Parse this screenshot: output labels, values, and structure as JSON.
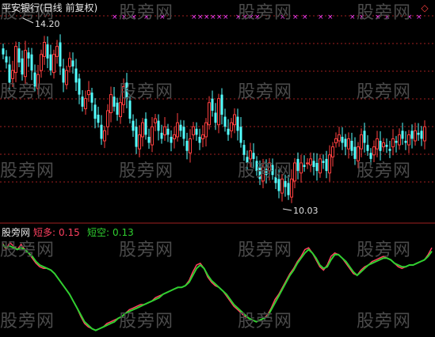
{
  "header": {
    "title": "平安银行(日线 前复权)"
  },
  "price_panel": {
    "high_label": "14.20",
    "low_label": "10.03"
  },
  "indicator_panel": {
    "name": "股旁网",
    "short_long_label": "短多:",
    "short_long_value": "0.15",
    "short_empty_label": "短空:",
    "short_empty_value": "0.13"
  },
  "watermark": "股旁网",
  "icons": {
    "corner": "diamond-icon"
  },
  "colors": {
    "up": "#ff4040",
    "down": "#54ffff",
    "short_long": "#ff4060",
    "short_empty": "#30d030",
    "signal": "#ff40ff",
    "grid": "#a02020"
  },
  "chart_data": [
    {
      "type": "candlestick",
      "ylim": [
        9.6,
        14.6
      ],
      "high": 14.2,
      "low": 10.03,
      "close": [
        13.6,
        13.4,
        12.9,
        13.2,
        13.8,
        13.4,
        13.1,
        13.7,
        13.5,
        13.2,
        12.8,
        13.1,
        13.6,
        13.9,
        13.5,
        13.2,
        13.6,
        13.8,
        13.3,
        12.9,
        13.2,
        13.5,
        13.3,
        12.9,
        12.6,
        12.3,
        12.5,
        12.7,
        12.4,
        12.0,
        11.9,
        11.5,
        11.7,
        12.2,
        12.6,
        12.3,
        12.1,
        12.4,
        12.8,
        12.5,
        12.0,
        11.7,
        11.3,
        11.6,
        11.9,
        11.6,
        11.4,
        11.8,
        12.0,
        11.7,
        11.5,
        11.8,
        11.6,
        11.4,
        11.6,
        11.9,
        11.7,
        11.5,
        11.2,
        11.5,
        11.8,
        11.6,
        11.4,
        11.6,
        11.9,
        12.4,
        12.2,
        11.9,
        12.5,
        12.1,
        11.8,
        11.6,
        11.9,
        12.1,
        11.7,
        11.4,
        11.1,
        10.9,
        11.2,
        11.0,
        10.7,
        10.5,
        10.8,
        10.6,
        10.9,
        10.6,
        10.4,
        10.2,
        10.5,
        10.3,
        10.1,
        10.5,
        10.9,
        10.7,
        10.9,
        10.8,
        10.9,
        11.0,
        10.8,
        10.7,
        11.0,
        10.9,
        10.7,
        11.1,
        11.3,
        11.5,
        11.6,
        11.4,
        11.3,
        11.5,
        11.2,
        11.0,
        11.3,
        11.6,
        11.4,
        11.2,
        11.0,
        11.3,
        11.5,
        11.2,
        11.4,
        11.3,
        11.2,
        11.5,
        11.4,
        11.6,
        11.5,
        11.4,
        11.6,
        11.5,
        11.7,
        11.6,
        11.5,
        11.8
      ]
    },
    {
      "type": "line",
      "ylim": [
        -0.35,
        0.22
      ],
      "series": [
        {
          "name": "短多",
          "values": [
            0.18,
            0.14,
            0.18,
            0.16,
            0.14,
            0.17,
            0.14,
            0.12,
            0.09,
            0.06,
            0.04,
            0.03,
            0.03,
            0.02,
            0.0,
            -0.03,
            -0.06,
            -0.09,
            -0.12,
            -0.16,
            -0.2,
            -0.25,
            -0.29,
            -0.31,
            -0.32,
            -0.33,
            -0.32,
            -0.31,
            -0.29,
            -0.28,
            -0.27,
            -0.26,
            -0.25,
            -0.23,
            -0.21,
            -0.2,
            -0.19,
            -0.18,
            -0.18,
            -0.17,
            -0.16,
            -0.14,
            -0.13,
            -0.12,
            -0.11,
            -0.1,
            -0.09,
            -0.08,
            -0.08,
            -0.07,
            -0.04,
            0.01,
            0.05,
            0.06,
            0.03,
            -0.02,
            -0.05,
            -0.07,
            -0.08,
            -0.1,
            -0.13,
            -0.16,
            -0.19,
            -0.21,
            -0.23,
            -0.25,
            -0.26,
            -0.27,
            -0.28,
            -0.27,
            -0.26,
            -0.24,
            -0.2,
            -0.15,
            -0.12,
            -0.08,
            -0.04,
            0.0,
            0.03,
            0.07,
            0.1,
            0.14,
            0.15,
            0.12,
            0.08,
            0.04,
            0.02,
            0.05,
            0.1,
            0.12,
            0.11,
            0.09,
            0.06,
            0.03,
            0.0,
            -0.01,
            0.02,
            0.04,
            0.05,
            0.07,
            0.08,
            0.09,
            0.1,
            0.09,
            0.08,
            0.06,
            0.04,
            0.03,
            0.04,
            0.05,
            0.05,
            0.06,
            0.07,
            0.08,
            0.11,
            0.15
          ]
        },
        {
          "name": "短空",
          "values": [
            0.17,
            0.15,
            0.16,
            0.15,
            0.14,
            0.15,
            0.14,
            0.12,
            0.1,
            0.07,
            0.05,
            0.04,
            0.03,
            0.02,
            0.0,
            -0.03,
            -0.06,
            -0.09,
            -0.12,
            -0.16,
            -0.2,
            -0.24,
            -0.28,
            -0.3,
            -0.32,
            -0.33,
            -0.32,
            -0.31,
            -0.3,
            -0.29,
            -0.28,
            -0.26,
            -0.25,
            -0.23,
            -0.22,
            -0.21,
            -0.2,
            -0.19,
            -0.18,
            -0.17,
            -0.16,
            -0.15,
            -0.14,
            -0.12,
            -0.11,
            -0.1,
            -0.09,
            -0.08,
            -0.08,
            -0.07,
            -0.05,
            -0.01,
            0.03,
            0.05,
            0.03,
            -0.01,
            -0.04,
            -0.06,
            -0.08,
            -0.1,
            -0.12,
            -0.15,
            -0.18,
            -0.2,
            -0.22,
            -0.24,
            -0.26,
            -0.27,
            -0.28,
            -0.27,
            -0.26,
            -0.25,
            -0.21,
            -0.17,
            -0.13,
            -0.09,
            -0.05,
            -0.01,
            0.02,
            0.06,
            0.09,
            0.12,
            0.14,
            0.12,
            0.09,
            0.05,
            0.03,
            0.04,
            0.08,
            0.11,
            0.11,
            0.09,
            0.07,
            0.04,
            0.01,
            -0.01,
            0.01,
            0.03,
            0.05,
            0.06,
            0.07,
            0.08,
            0.09,
            0.09,
            0.08,
            0.06,
            0.05,
            0.04,
            0.04,
            0.05,
            0.05,
            0.06,
            0.07,
            0.08,
            0.1,
            0.13
          ]
        }
      ]
    }
  ]
}
